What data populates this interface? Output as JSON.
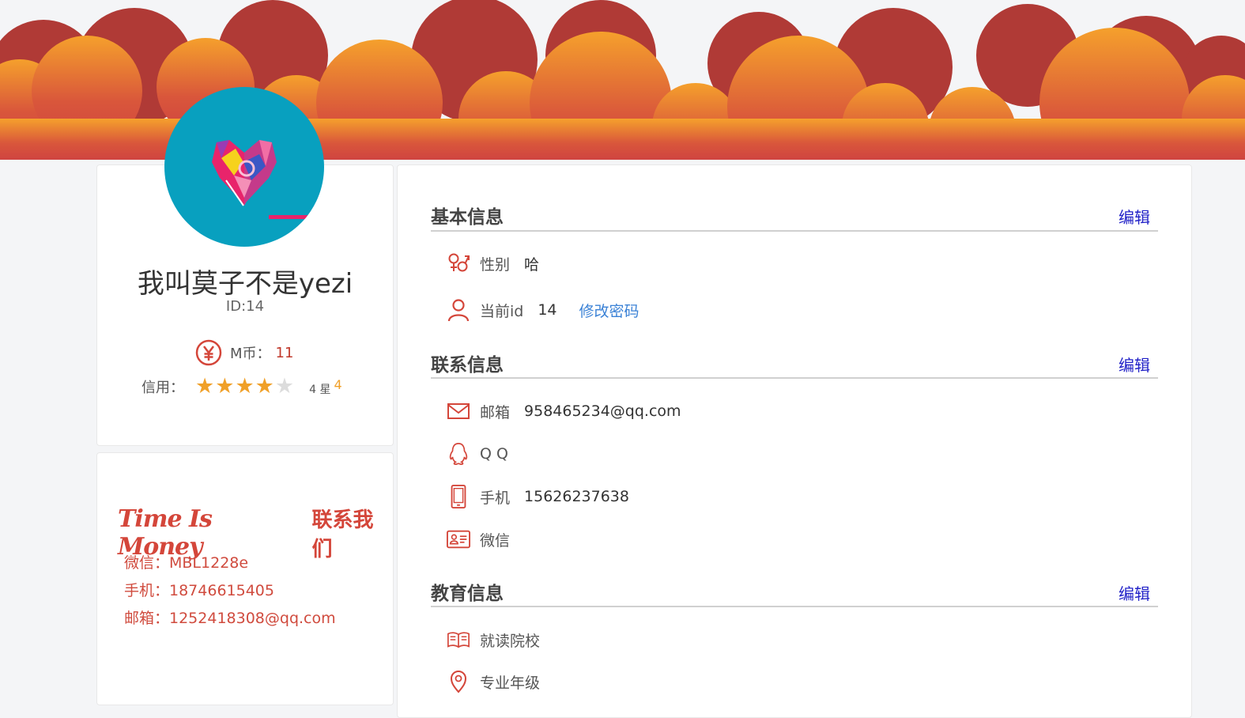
{
  "profile": {
    "username": "我叫莫子不是yezi",
    "id_text": "ID:14",
    "coins_label": "M币：",
    "coins_value": "11",
    "credit_label": "信用：",
    "credit_stars": 4,
    "credit_max": 5,
    "credit_text": "4 星",
    "credit_score": "4"
  },
  "contact_us": {
    "motto": "Time Is Money",
    "title": "联系我们",
    "wechat": "微信：MBL1228e",
    "phone": "手机：18746615405",
    "email": "邮箱：1252418308@qq.com"
  },
  "basic_info": {
    "title": "基本信息",
    "edit": "编辑",
    "gender_label": "性别",
    "gender_value": "哈",
    "id_label": "当前id",
    "id_value": "14",
    "change_password": "修改密码"
  },
  "contact_info": {
    "title": "联系信息",
    "edit": "编辑",
    "email_label": "邮箱",
    "email_value": "958465234@qq.com",
    "qq_label": "Q Q",
    "phone_label": "手机",
    "phone_value": "15626237638",
    "wechat_label": "微信"
  },
  "education_info": {
    "title": "教育信息",
    "edit": "编辑",
    "school_label": "就读院校",
    "major_label": "专业年级"
  },
  "colors": {
    "banner_dark": "#b03a36",
    "banner_orange": "#f39a2e",
    "accent_red": "#d4463a",
    "edit_link": "#2323c8",
    "link_blue": "#3b82d6",
    "star": "#f0a028",
    "avatar_bg": "#08a0bf"
  }
}
